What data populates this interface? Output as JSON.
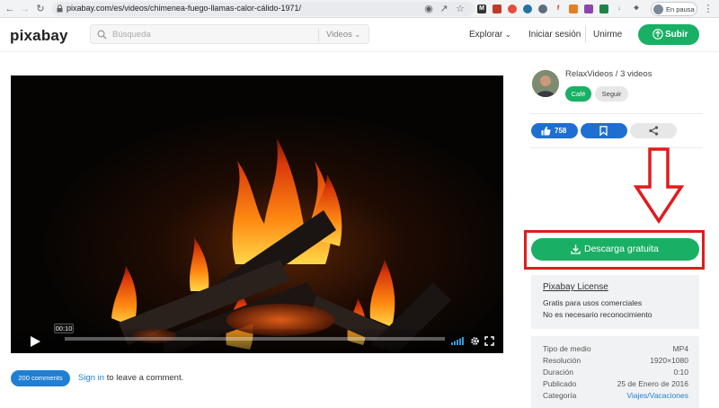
{
  "browser": {
    "url": "pixabay.com/es/videos/chimenea-fuego-llamas-calor-cálido-1971/",
    "profile_label": "En pausa"
  },
  "header": {
    "logo": "pixabay",
    "search_placeholder": "Búsqueda",
    "search_type": "Videos",
    "nav_explore": "Explorar",
    "nav_login": "Iniciar sesión",
    "nav_join": "Unirme",
    "upload_label": "Subir"
  },
  "player": {
    "time": "00:10",
    "progress": 0.0
  },
  "comments": {
    "count_label": "200 comments",
    "signin_link": "Sign in",
    "signin_rest": " to leave a comment."
  },
  "author": {
    "name_line": "RelaxVideos / 3 videos",
    "tag_coffee": "Café",
    "follow_label": "Seguir"
  },
  "actions": {
    "likes": "758"
  },
  "download": {
    "label": "Descarga gratuita"
  },
  "license": {
    "title": "Pixabay License",
    "line1": "Gratis para usos comerciales",
    "line2": "No es necesario reconocimiento"
  },
  "info": {
    "rows": [
      {
        "k": "Tipo de medio",
        "v": "MP4"
      },
      {
        "k": "Resolución",
        "v": "1920×1080"
      },
      {
        "k": "Duración",
        "v": "0:10"
      },
      {
        "k": "Publicado",
        "v": "25 de Enero de 2016"
      },
      {
        "k": "Categoría",
        "v": "Viajes/Vacaciones"
      }
    ]
  },
  "colors": {
    "brand_green": "#19b065",
    "action_blue": "#1f6fd1",
    "highlight_red": "#e01b1b"
  }
}
